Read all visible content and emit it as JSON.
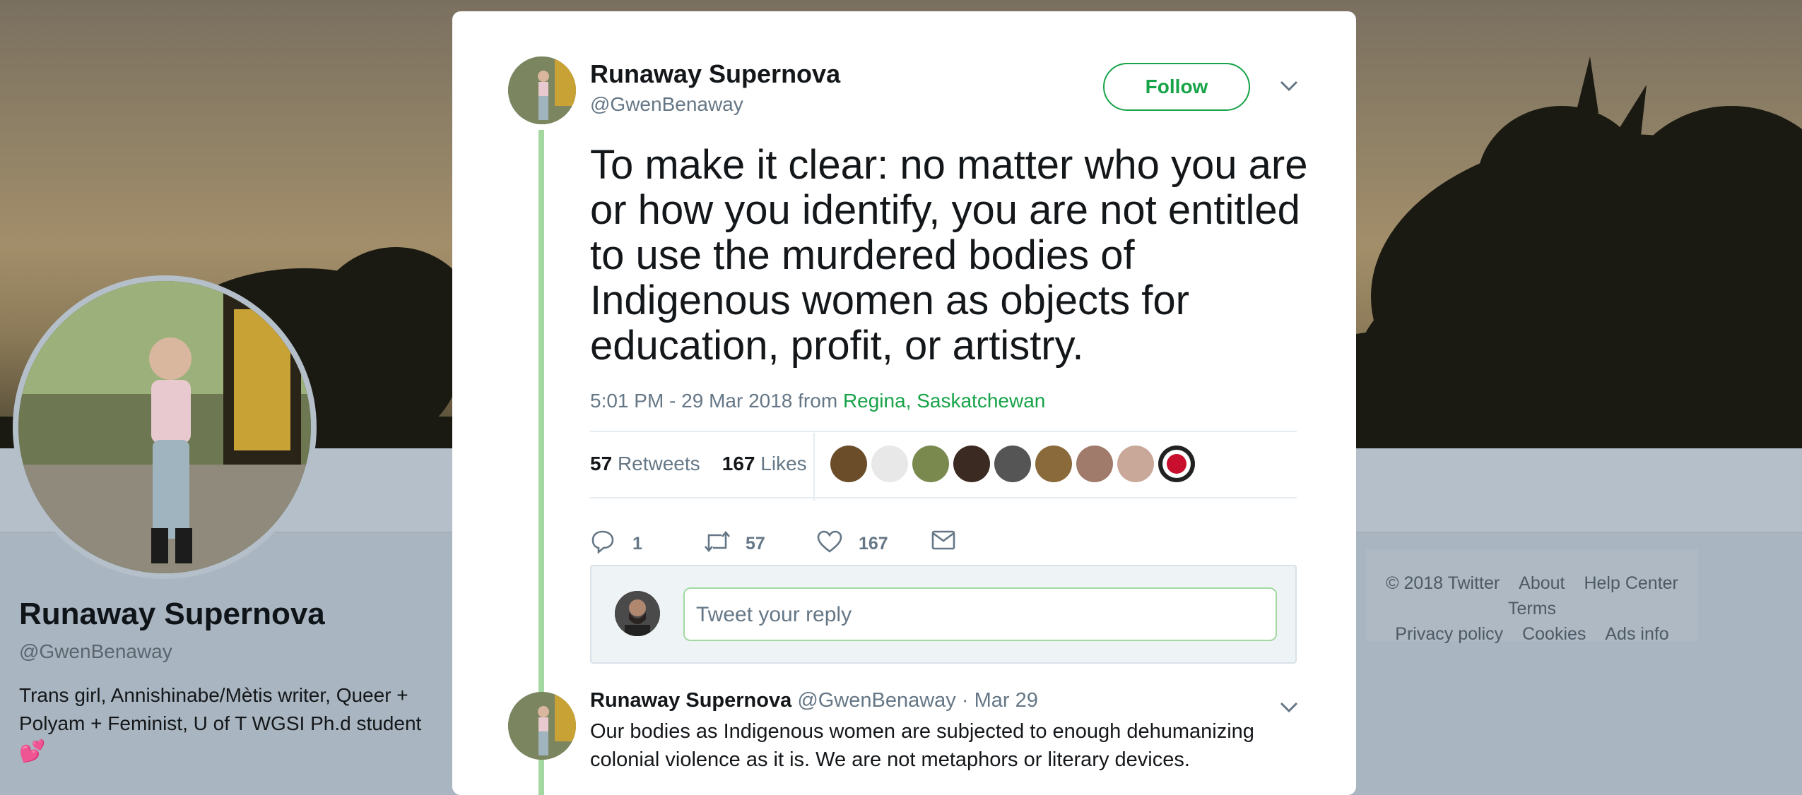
{
  "profile": {
    "name": "Runaway Supernova",
    "handle": "@GwenBenaway",
    "bio": "Trans girl, Annishinabe/Mètis writer, Queer + Polyam + Feminist, U of T WGSI Ph.d student",
    "bio_emoji": "💕"
  },
  "footer": {
    "links_row1": [
      "© 2018 Twitter",
      "About",
      "Help Center",
      "Terms"
    ],
    "links_row2": [
      "Privacy policy",
      "Cookies",
      "Ads info"
    ]
  },
  "tweet": {
    "author_name": "Runaway Supernova",
    "author_handle": "@GwenBenaway",
    "follow_label": "Follow",
    "text": "To make it clear: no matter who you are or how you identify, you are not entitled to use the murdered bodies of Indigenous women as objects for education, profit, or artistry.",
    "timestamp": "5:01 PM - 29 Mar 2018 from",
    "location": "Regina, Saskatchewan",
    "retweets_count": "57",
    "retweets_label": "Retweets",
    "likes_count": "167",
    "likes_label": "Likes",
    "liker_avatar_count": 9,
    "actions": {
      "reply_count": "1",
      "retweet_count": "57",
      "like_count": "167"
    },
    "reply_placeholder": "Tweet your reply"
  },
  "reply_tweet": {
    "author_name": "Runaway Supernova",
    "author_handle": "@GwenBenaway",
    "separator": "·",
    "date": "Mar 29",
    "text": "Our bodies as Indigenous women are subjected to enough dehumanizing colonial violence as it is. We are not metaphors or literary devices."
  },
  "icons": [
    "reply-icon",
    "retweet-icon",
    "like-icon",
    "message-icon",
    "chevron-down-icon"
  ],
  "colors": {
    "accent": "#17a348",
    "thread_line": "#a3d9a1",
    "muted_text": "#657786"
  }
}
